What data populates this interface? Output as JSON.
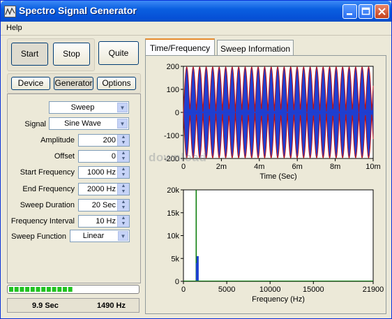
{
  "window": {
    "title": "Spectro Signal Generator"
  },
  "menu": {
    "help": "Help"
  },
  "controls": {
    "start": "Start",
    "stop": "Stop",
    "quite": "Quite"
  },
  "subtabs": {
    "device": "Device",
    "generator": "Generator",
    "options": "Options"
  },
  "generator": {
    "mode": "Sweep",
    "signal_label": "Signal",
    "signal": "Sine Wave",
    "fields": [
      {
        "label": "Amplitude",
        "value": "200"
      },
      {
        "label": "Offset",
        "value": "0"
      },
      {
        "label": "Start Frequency",
        "value": "1000 Hz"
      },
      {
        "label": "End Frequency",
        "value": "2000 Hz"
      },
      {
        "label": "Sweep Duration",
        "value": "20 Sec"
      },
      {
        "label": "Frequency Interval",
        "value": "10 Hz"
      }
    ],
    "sweep_function_label": "Sweep Function",
    "sweep_function": "Linear"
  },
  "progress": {
    "fraction": 0.49,
    "color": "#22c322"
  },
  "status": {
    "time": "9.9 Sec",
    "freq": "1490 Hz"
  },
  "tabs": {
    "time_freq": "Time/Frequency",
    "sweep_info": "Sweep Information"
  },
  "watermark": "download",
  "chart_data": [
    {
      "type": "line",
      "name": "time",
      "xlabel": "Time (Sec)",
      "ylabel": "",
      "xlim": [
        0,
        10
      ],
      "ylim": [
        -200,
        200
      ],
      "xticks": [
        "0",
        "2m",
        "4m",
        "6m",
        "8m",
        "10m"
      ],
      "yticks": [
        "200",
        "100",
        "0",
        "-100",
        "-200"
      ],
      "amplitude": 200,
      "series_colors": [
        "#1f3fd0",
        "#c01010"
      ]
    },
    {
      "type": "bar",
      "name": "frequency",
      "xlabel": "Frequency (Hz)",
      "ylabel": "",
      "xlim": [
        0,
        21900
      ],
      "ylim": [
        0,
        20000
      ],
      "xticks": [
        "0",
        "5000",
        "10000",
        "15000",
        "21900"
      ],
      "yticks": [
        "20k",
        "15k",
        "10k",
        "5k",
        "0"
      ],
      "points": [
        [
          1490,
          20000
        ],
        [
          1600,
          5500
        ],
        [
          1520,
          4000
        ]
      ],
      "colors": [
        "#108010",
        "#1a3fd0"
      ]
    }
  ]
}
